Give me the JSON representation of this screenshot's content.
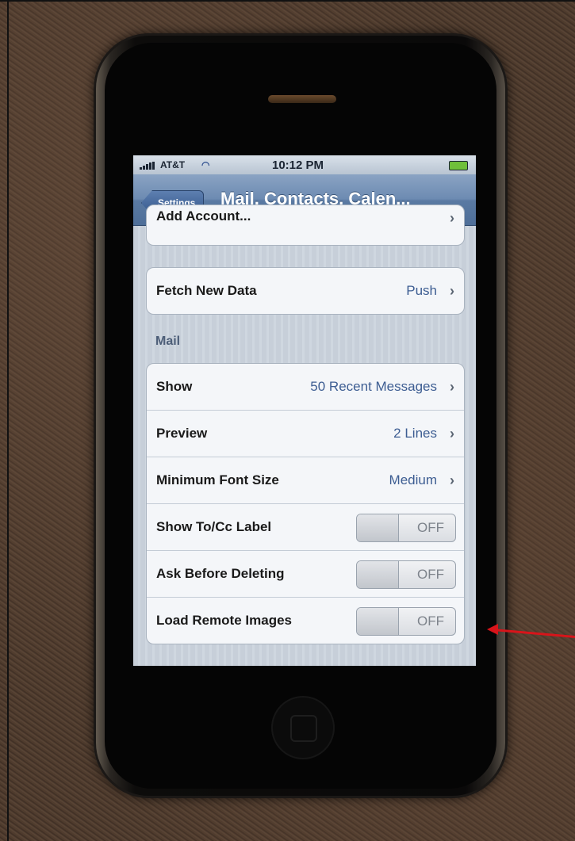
{
  "status_bar": {
    "carrier": "AT&T",
    "time": "10:12 PM",
    "wifi_icon": "wifi-icon",
    "battery_icon": "battery-icon"
  },
  "nav_bar": {
    "back_label": "Settings",
    "title": "Mail, Contacts, Calen..."
  },
  "account_group": {
    "partial_label": "Add Account..."
  },
  "fetch_group": {
    "label": "Fetch New Data",
    "value": "Push"
  },
  "mail_section": {
    "header": "Mail",
    "rows": [
      {
        "label": "Show",
        "value": "50 Recent Messages",
        "type": "disclosure"
      },
      {
        "label": "Preview",
        "value": "2 Lines",
        "type": "disclosure"
      },
      {
        "label": "Minimum Font Size",
        "value": "Medium",
        "type": "disclosure"
      },
      {
        "label": "Show To/Cc Label",
        "value": "OFF",
        "type": "switch"
      },
      {
        "label": "Ask Before Deleting",
        "value": "OFF",
        "type": "switch"
      },
      {
        "label": "Load Remote Images",
        "value": "OFF",
        "type": "switch"
      }
    ]
  },
  "colors": {
    "nav_blue": "#5a7aa3",
    "value_blue": "#3d5d92",
    "annotation_red": "#d8141a"
  }
}
